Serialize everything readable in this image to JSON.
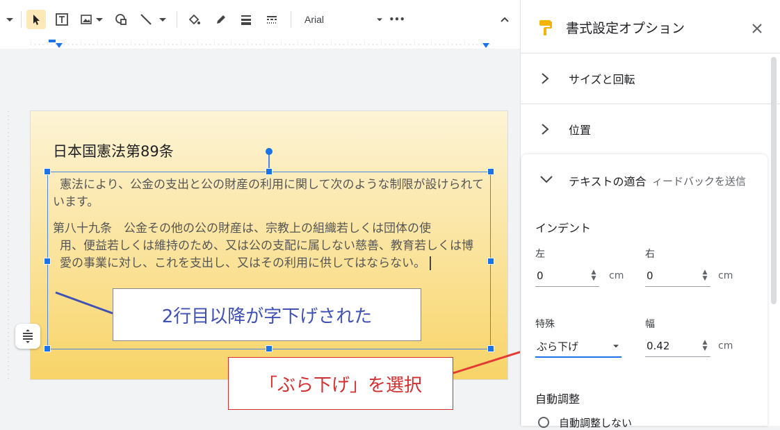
{
  "toolbar": {
    "font_name": "Arial",
    "more_label": "•••",
    "tools": [
      "chevron-down-icon",
      "cursor-icon",
      "textbox-icon",
      "image-icon",
      "shape-icon",
      "line-icon",
      "fill-color-icon",
      "border-color-icon",
      "border-weight-icon",
      "border-dash-icon"
    ]
  },
  "slide": {
    "title": "日本国憲法第89条",
    "paragraph1": "憲法により、公金の支出と公の財産の利用に関して次のような制限が設けられています。",
    "paragraph2_line1": "第八十九条　公金その他の公の財産は、宗教上の組織若しくは団体の使",
    "paragraph2_rest": "用、便益若しくは維持のため、又は公の支配に属しない慈善、教育若しくは博愛の事業に対し、これを支出し、又はその利用に供してはならない。"
  },
  "callouts": {
    "indent_note": "2行目以降が字下げされた",
    "hanging_note": "「ぶら下げ」を選択"
  },
  "panel": {
    "title": "書式設定オプション",
    "sections": {
      "size_rotation": "サイズと回転",
      "position": "位置",
      "text_fit": "テキストの適合"
    },
    "feedback_tooltip": "ィードバックを送信",
    "indent": {
      "heading": "インデント",
      "left_label": "左",
      "left_value": "0",
      "right_label": "右",
      "right_value": "0",
      "unit": "cm",
      "special_label": "特殊",
      "special_value": "ぶら下げ",
      "width_label": "幅",
      "width_value": "0.42"
    },
    "autofit": {
      "heading": "自動調整",
      "option_none": "自動調整しない"
    }
  },
  "colors": {
    "accent": "#1a73e8",
    "callout_blue": "#3f51b5",
    "callout_red": "#d32f2f",
    "slide_top": "#fdf4d6",
    "slide_bottom": "#f8d468"
  }
}
